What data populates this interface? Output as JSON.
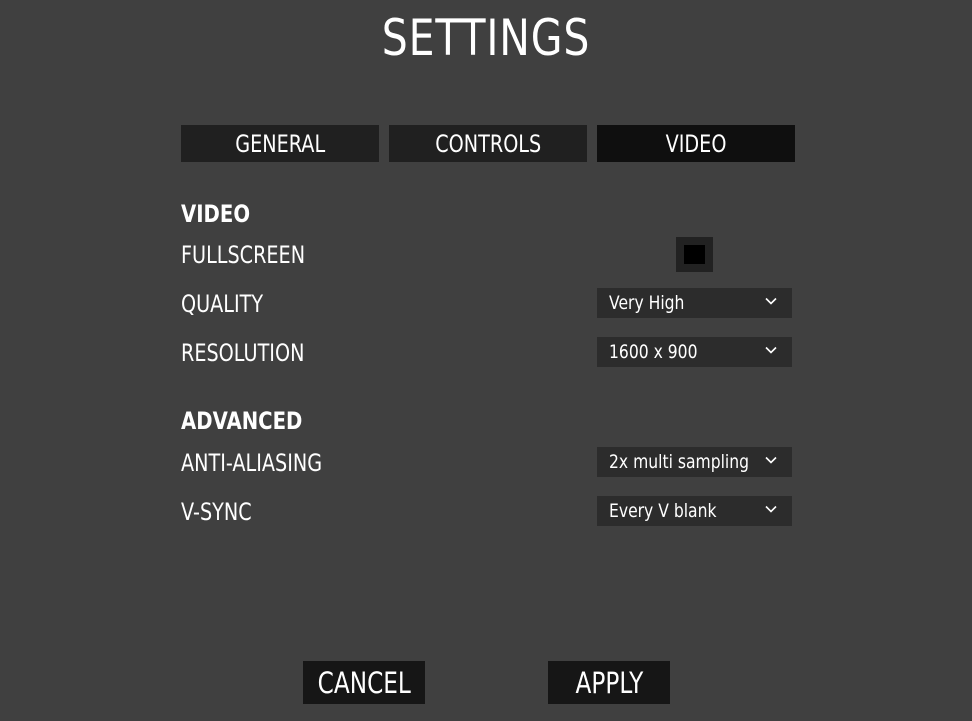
{
  "title": "SETTINGS",
  "tabs": [
    {
      "label": "GENERAL",
      "active": false
    },
    {
      "label": "CONTROLS",
      "active": false
    },
    {
      "label": "VIDEO",
      "active": true
    }
  ],
  "video_section": {
    "heading": "VIDEO",
    "fullscreen_label": "FULLSCREEN",
    "fullscreen_checked": true,
    "quality_label": "QUALITY",
    "quality_value": "Very High",
    "resolution_label": "RESOLUTION",
    "resolution_value": "1600 x 900"
  },
  "advanced_section": {
    "heading": "ADVANCED",
    "antialiasing_label": "ANTI-ALIASING",
    "antialiasing_value": "2x multi sampling",
    "vsync_label": "V-SYNC",
    "vsync_value": "Every V blank"
  },
  "buttons": {
    "cancel_label": "CANCEL",
    "apply_label": "APPLY"
  },
  "colors": {
    "background": "#404040",
    "tab_bg": "#202020",
    "tab_active_bg": "#0f0f0f",
    "select_bg": "#2c2c2c",
    "button_bg": "#161616",
    "text": "#ffffff"
  },
  "icons": {
    "dropdown": "chevron-down-icon",
    "checkbox": "checkbox-checked"
  }
}
